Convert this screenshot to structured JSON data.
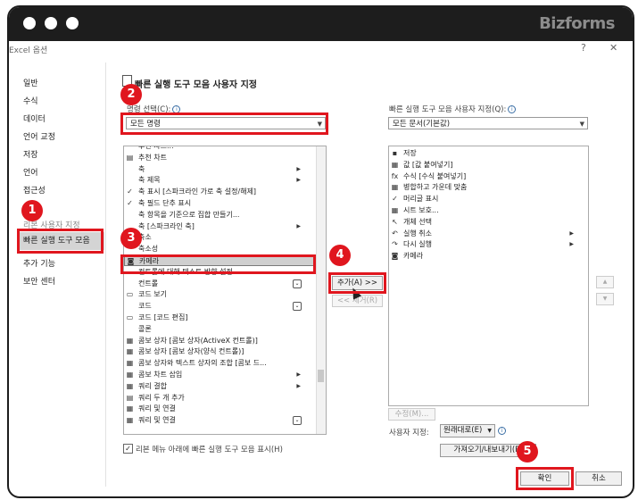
{
  "brand": "Bizforms",
  "dialog": {
    "title": "Excel 옵션",
    "help": "?",
    "close": "✕"
  },
  "nav": [
    {
      "label": "일반"
    },
    {
      "label": "수식"
    },
    {
      "label": "데이터"
    },
    {
      "label": "언어 교정"
    },
    {
      "label": "저장"
    },
    {
      "label": "언어"
    },
    {
      "label": "접근성"
    },
    {
      "label": "리본 사용자 지정"
    },
    {
      "label": "빠른 실행 도구 모음"
    },
    {
      "label": "추가 기능"
    },
    {
      "label": "보안 센터"
    }
  ],
  "header": "빠른 실행 도구 모음 사용자 지정",
  "left": {
    "label": "명령 선택(C):",
    "dropdown": "모든 명령",
    "items": [
      {
        "icon": "",
        "text": "추천 차트..."
      },
      {
        "icon": "▤",
        "text": "추천 차트"
      },
      {
        "icon": "",
        "text": "축",
        "sub": "▶"
      },
      {
        "icon": "",
        "text": "축 제목",
        "sub": "▶"
      },
      {
        "icon": "✓",
        "text": "축 표시 [스파크라인 가로 축 설정/해제]"
      },
      {
        "icon": "✓",
        "text": "축 필드 단추 표시"
      },
      {
        "icon": "",
        "text": "축 항목을 기준으로 집합 만들기..."
      },
      {
        "icon": "",
        "text": "축 [스파크라인 축]",
        "sub": "▶"
      },
      {
        "icon": "",
        "text": "축소"
      },
      {
        "icon": "",
        "text": "축소성"
      },
      {
        "icon": "◙",
        "text": "카메라"
      },
      {
        "icon": "",
        "text": "컨트롤에 대해 텍스트 방향 설정"
      },
      {
        "icon": "",
        "text": "컨트롤",
        "mini": "⌄"
      },
      {
        "icon": "▭",
        "text": "코드 보기"
      },
      {
        "icon": "",
        "text": "코드",
        "mini": "⌄"
      },
      {
        "icon": "▭",
        "text": "코드 [코드 편집]"
      },
      {
        "icon": "",
        "text": "콜론"
      },
      {
        "icon": "▦",
        "text": "콤보 상자 [콤보 상자(ActiveX 컨트롤)]"
      },
      {
        "icon": "▦",
        "text": "콤보 상자 [콤보 상자(양식 컨트롤)]"
      },
      {
        "icon": "▦",
        "text": "콤보 상자와 텍스트 상자의 조합 [콤보 드..."
      },
      {
        "icon": "▦",
        "text": "콤보 차트 삽입",
        "sub": "▶"
      },
      {
        "icon": "▦",
        "text": "쿼리 결합",
        "sub": "▶"
      },
      {
        "icon": "▤",
        "text": "쿼리 두 개 추가"
      },
      {
        "icon": "▦",
        "text": "쿼리 및 연결"
      },
      {
        "icon": "▦",
        "text": "쿼리 및 연결",
        "mini": "⌄"
      }
    ]
  },
  "right": {
    "label": "빠른 실행 도구 모음 사용자 지정(Q):",
    "dropdown": "모든 문서(기본값)",
    "items": [
      {
        "icon": "▪",
        "text": "저장"
      },
      {
        "icon": "▦",
        "text": "값 [값 붙여넣기]"
      },
      {
        "icon": "fx",
        "text": "수식 [수식 붙여넣기]"
      },
      {
        "icon": "▦",
        "text": "병합하고 가운데 맞춤"
      },
      {
        "icon": "✓",
        "text": "머리글 표시"
      },
      {
        "icon": "▦",
        "text": "시트 보호..."
      },
      {
        "icon": "↖",
        "text": "개체 선택"
      },
      {
        "icon": "↶",
        "text": "실행 취소",
        "sub": "▶"
      },
      {
        "icon": "↷",
        "text": "다시 실행",
        "sub": "▶"
      },
      {
        "icon": "◙",
        "text": "카메라"
      }
    ]
  },
  "buttons": {
    "add": "추가(A) >>",
    "remove": "<< 제거(R)",
    "modify": "수정(M)...",
    "customize_label": "사용자 지정:",
    "reset": "원래대로(E)",
    "import_export": "가져오기/내보내기(P)",
    "ok": "확인",
    "cancel": "취소"
  },
  "checkbox": "리본 메뉴 아래에 빠른 실행 도구 모음 표시(H)",
  "badges": [
    "1",
    "2",
    "3",
    "4",
    "5"
  ],
  "colors": {
    "highlight": "#e0161e",
    "titlebar": "#1d1d1d"
  }
}
